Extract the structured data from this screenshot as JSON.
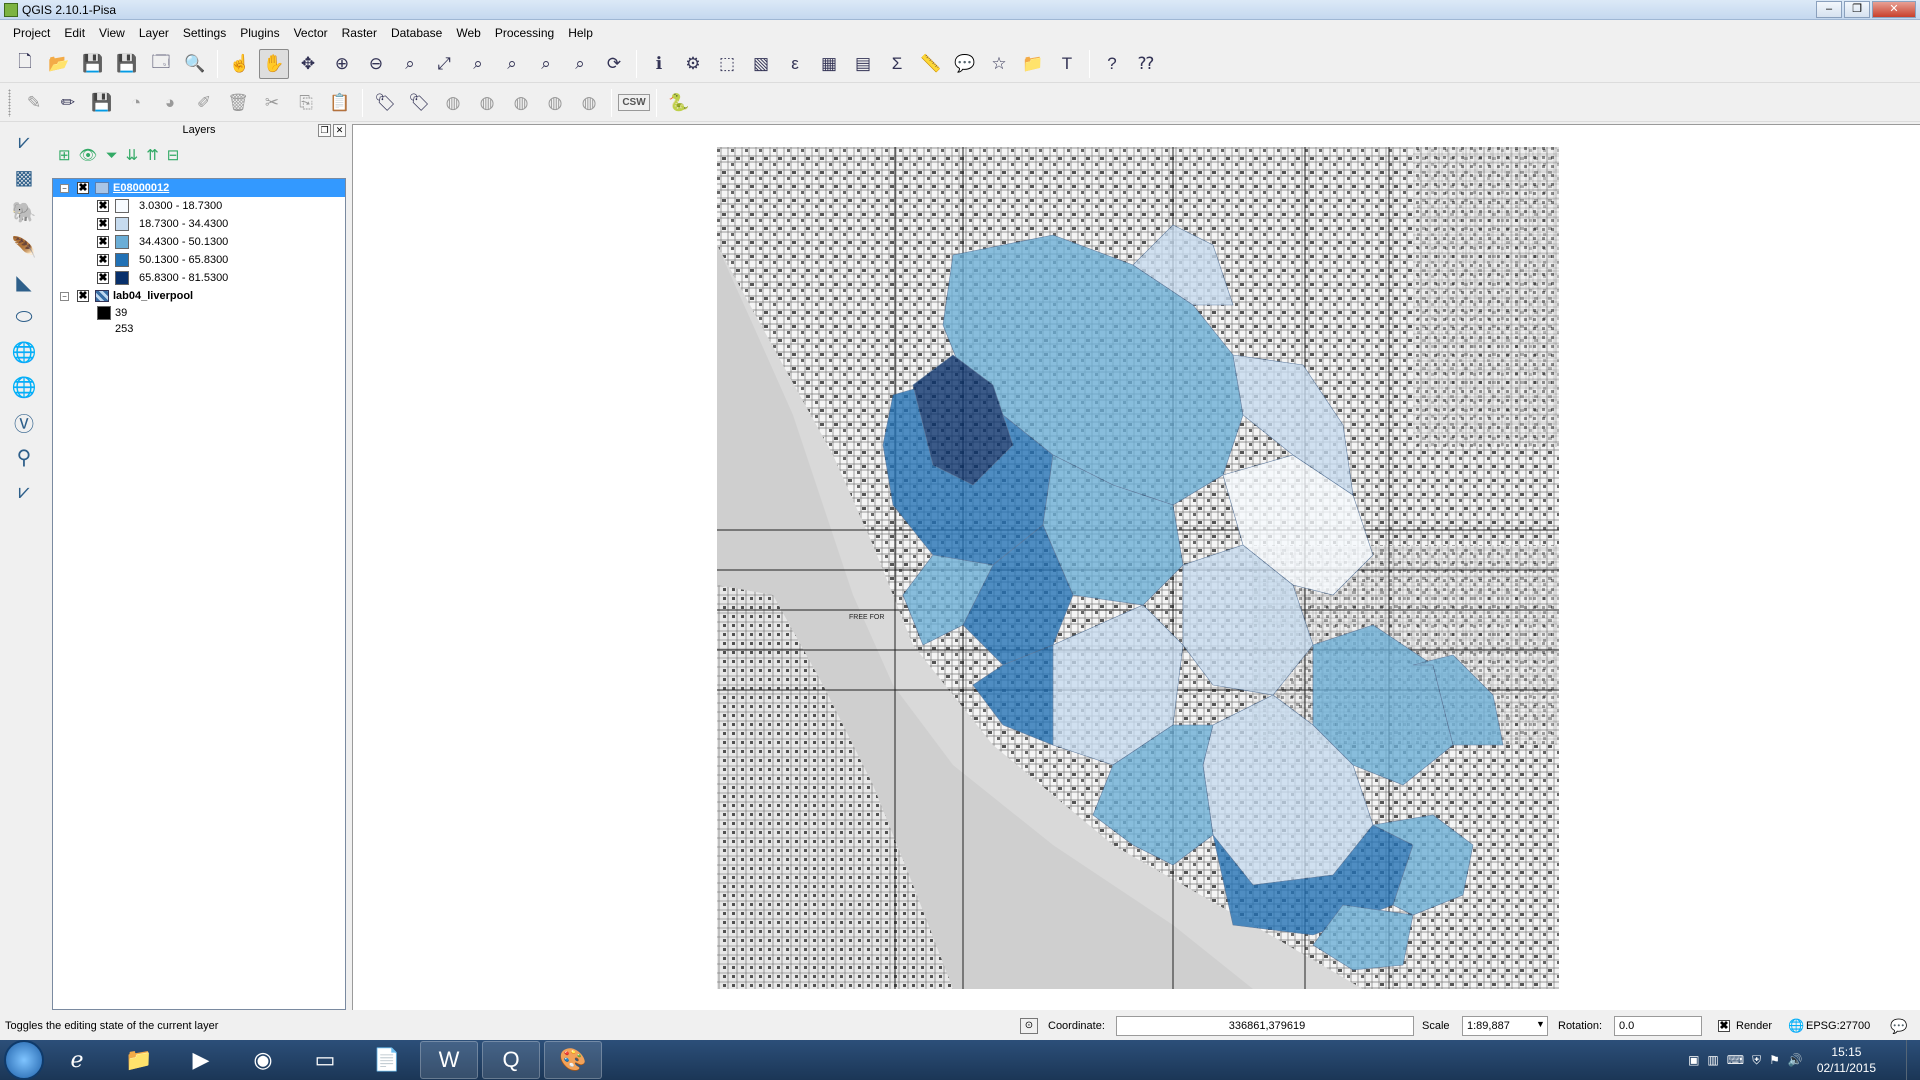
{
  "window": {
    "title": "QGIS 2.10.1-Pisa"
  },
  "menu": [
    "Project",
    "Edit",
    "View",
    "Layer",
    "Settings",
    "Plugins",
    "Vector",
    "Raster",
    "Database",
    "Web",
    "Processing",
    "Help"
  ],
  "layers_panel": {
    "title": "Layers",
    "layers": [
      {
        "name": "E08000012",
        "checked": "✖",
        "selected": true,
        "classes": [
          {
            "label": "3.0300 - 18.7300",
            "color": "#f7fbff"
          },
          {
            "label": "18.7300 - 34.4300",
            "color": "#c6dbef"
          },
          {
            "label": "34.4300 - 50.1300",
            "color": "#6baed6"
          },
          {
            "label": "50.1300 - 65.8300",
            "color": "#2171b5"
          },
          {
            "label": "65.8300 - 81.5300",
            "color": "#08306b"
          }
        ]
      },
      {
        "name": "lab04_liverpool",
        "checked": "✖",
        "raster_legend": [
          {
            "label": "39",
            "color": "#000000"
          },
          {
            "label": "253",
            "color": "#ffffff"
          }
        ]
      }
    ]
  },
  "statusbar": {
    "message": "Toggles the editing state of the current layer",
    "coordinate_label": "Coordinate:",
    "coordinate_value": "336861,379619",
    "scale_label": "Scale",
    "scale_value": "1:89,887",
    "rotation_label": "Rotation:",
    "rotation_value": "0.0",
    "render_label": "Render",
    "render_checked": "✖",
    "crs": "EPSG:27700"
  },
  "map": {
    "label": "FREE FOR"
  },
  "taskbar": {
    "clock_time": "15:15",
    "clock_date": "02/11/2015"
  }
}
